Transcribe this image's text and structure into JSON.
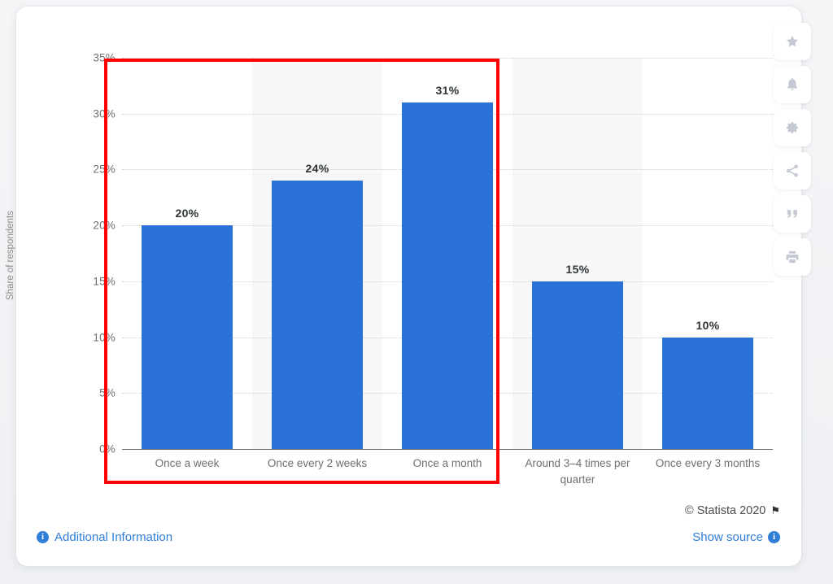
{
  "chart_data": {
    "type": "bar",
    "title": "",
    "xlabel": "",
    "ylabel": "Share of respondents",
    "ylim": [
      0,
      35
    ],
    "grid": true,
    "legend": "none",
    "categories": [
      "Once a week",
      "Once every 2 weeks",
      "Once a month",
      "Around 3–4 times per quarter",
      "Once every 3 months"
    ],
    "values": [
      20,
      24,
      31,
      15,
      10
    ],
    "value_labels": [
      "20%",
      "24%",
      "31%",
      "15%",
      "10%"
    ],
    "ytick_labels": [
      "35%",
      "30%",
      "25%",
      "20%",
      "15%",
      "10%",
      "5%",
      "0%"
    ],
    "ytick_values": [
      35,
      30,
      25,
      20,
      15,
      10,
      5,
      0
    ],
    "bar_color": "#2b71d8"
  },
  "annotation": {
    "shape": "rectangle",
    "color": "#ff0000",
    "covers": [
      "Once a week",
      "Once every 2 weeks",
      "Once a month"
    ]
  },
  "toolbar": {
    "items": [
      {
        "name": "star-icon",
        "label": "Favorite"
      },
      {
        "name": "bell-icon",
        "label": "Notify"
      },
      {
        "name": "gear-icon",
        "label": "Settings"
      },
      {
        "name": "share-icon",
        "label": "Share"
      },
      {
        "name": "quote-icon",
        "label": "Cite"
      },
      {
        "name": "print-icon",
        "label": "Print"
      }
    ]
  },
  "footer": {
    "copyright": "© Statista 2020",
    "flag_icon": "⚑",
    "additional_information": "Additional Information",
    "show_source": "Show source",
    "info_glyph": "i"
  }
}
